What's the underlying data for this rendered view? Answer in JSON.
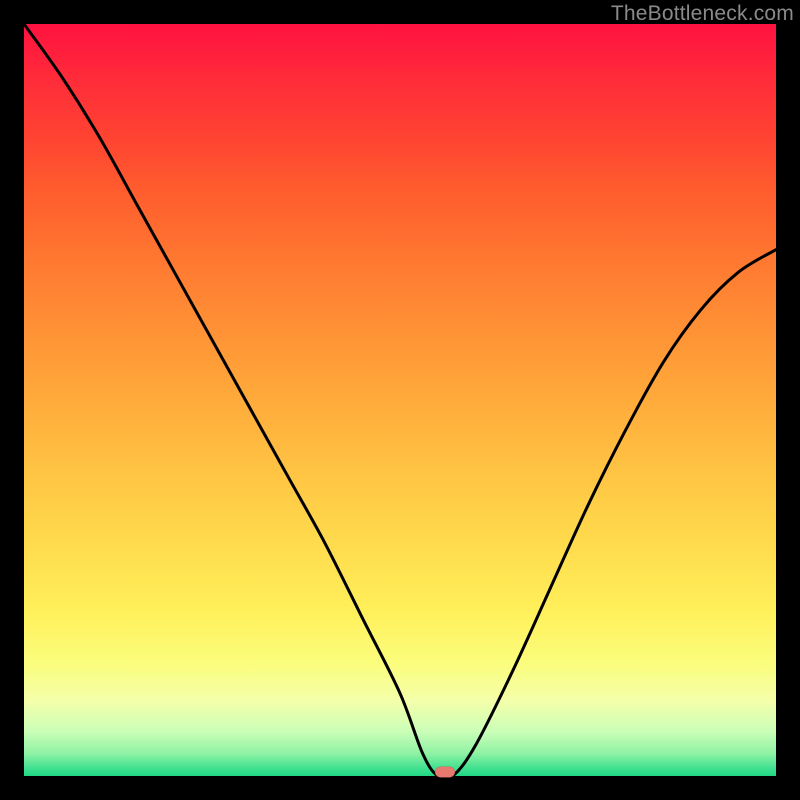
{
  "watermark": "TheBottleneck.com",
  "chart_data": {
    "type": "line",
    "title": "",
    "xlabel": "",
    "ylabel": "",
    "xlim": [
      0,
      100
    ],
    "ylim": [
      0,
      100
    ],
    "grid": false,
    "legend": false,
    "series": [
      {
        "name": "bottleneck-curve",
        "x": [
          0,
          5,
          10,
          15,
          20,
          25,
          30,
          35,
          40,
          45,
          50,
          53,
          55,
          57,
          60,
          65,
          70,
          75,
          80,
          85,
          90,
          95,
          100
        ],
        "values": [
          100,
          93,
          85,
          76,
          67,
          58,
          49,
          40,
          31,
          21,
          11,
          3,
          0,
          0,
          4,
          14,
          25,
          36,
          46,
          55,
          62,
          67,
          70
        ]
      }
    ],
    "marker": {
      "x": 56,
      "y": 0.5,
      "color": "#e77a6e"
    },
    "background_gradient": {
      "top": "#ff1240",
      "mid": "#ffd94a",
      "bottom": "#20d884"
    }
  }
}
